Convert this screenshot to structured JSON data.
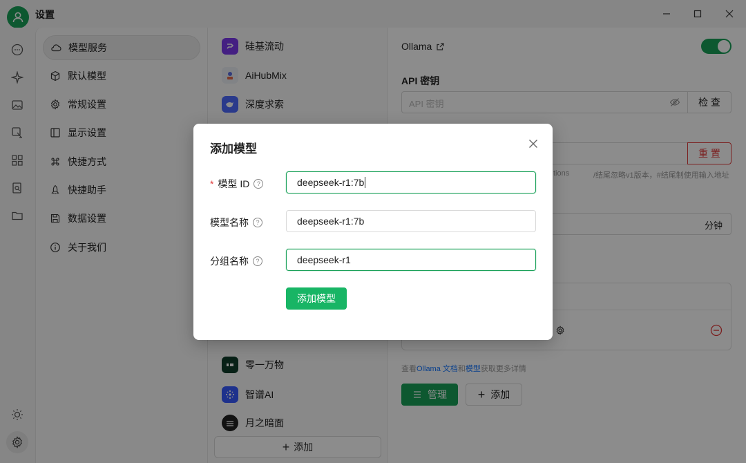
{
  "window": {
    "title": "设置"
  },
  "nav": {
    "items": [
      {
        "label": "模型服务",
        "icon": "cloud-icon",
        "active": true
      },
      {
        "label": "默认模型",
        "icon": "cube-icon",
        "active": false
      },
      {
        "label": "常规设置",
        "icon": "gear-icon",
        "active": false
      },
      {
        "label": "显示设置",
        "icon": "layout-icon",
        "active": false
      },
      {
        "label": "快捷方式",
        "icon": "command-icon",
        "active": false
      },
      {
        "label": "快捷助手",
        "icon": "rocket-icon",
        "active": false
      },
      {
        "label": "数据设置",
        "icon": "save-icon",
        "active": false
      },
      {
        "label": "关于我们",
        "icon": "info-icon",
        "active": false
      }
    ]
  },
  "providers": {
    "items": [
      {
        "name": "硅基流动",
        "color": "#7c3aed"
      },
      {
        "name": "AiHubMix",
        "color": "#e8e8f0"
      },
      {
        "name": "深度求索",
        "color": "#4d6bfe"
      },
      {
        "name": "零一万物",
        "color": "#0f3d2a"
      },
      {
        "name": "智谱AI",
        "color": "#3859ff"
      },
      {
        "name": "月之暗面",
        "color": "#222222"
      }
    ],
    "add_label": "添加"
  },
  "detail": {
    "provider_title": "Ollama",
    "api_key_label": "API 密钥",
    "api_key_placeholder": "API 密钥",
    "check_label": "检 查",
    "reset_label": "重 置",
    "hint_left": "tions",
    "hint_right": "/结尾忽略v1版本，#结尾制使用输入地址",
    "minutes_label": "分钟",
    "docs_text_1": "查看",
    "docs_link_1": "Ollama 文档",
    "docs_text_2": "和",
    "docs_link_2": "模型",
    "docs_text_3": "获取更多详情",
    "manage_label": "管理",
    "add_label": "添加",
    "toggle_on": true
  },
  "modal": {
    "title": "添加模型",
    "model_id_label": "模型 ID",
    "model_id_value": "deepseek-r1:7b",
    "model_name_label": "模型名称",
    "model_name_value": "deepseek-r1:7b",
    "group_name_label": "分组名称",
    "group_name_value": "deepseek-r1",
    "submit_label": "添加模型",
    "required_mark": "*",
    "help_mark": "?"
  },
  "colors": {
    "accent": "#18a058",
    "danger": "#e03a3a",
    "link": "#1677ff"
  }
}
